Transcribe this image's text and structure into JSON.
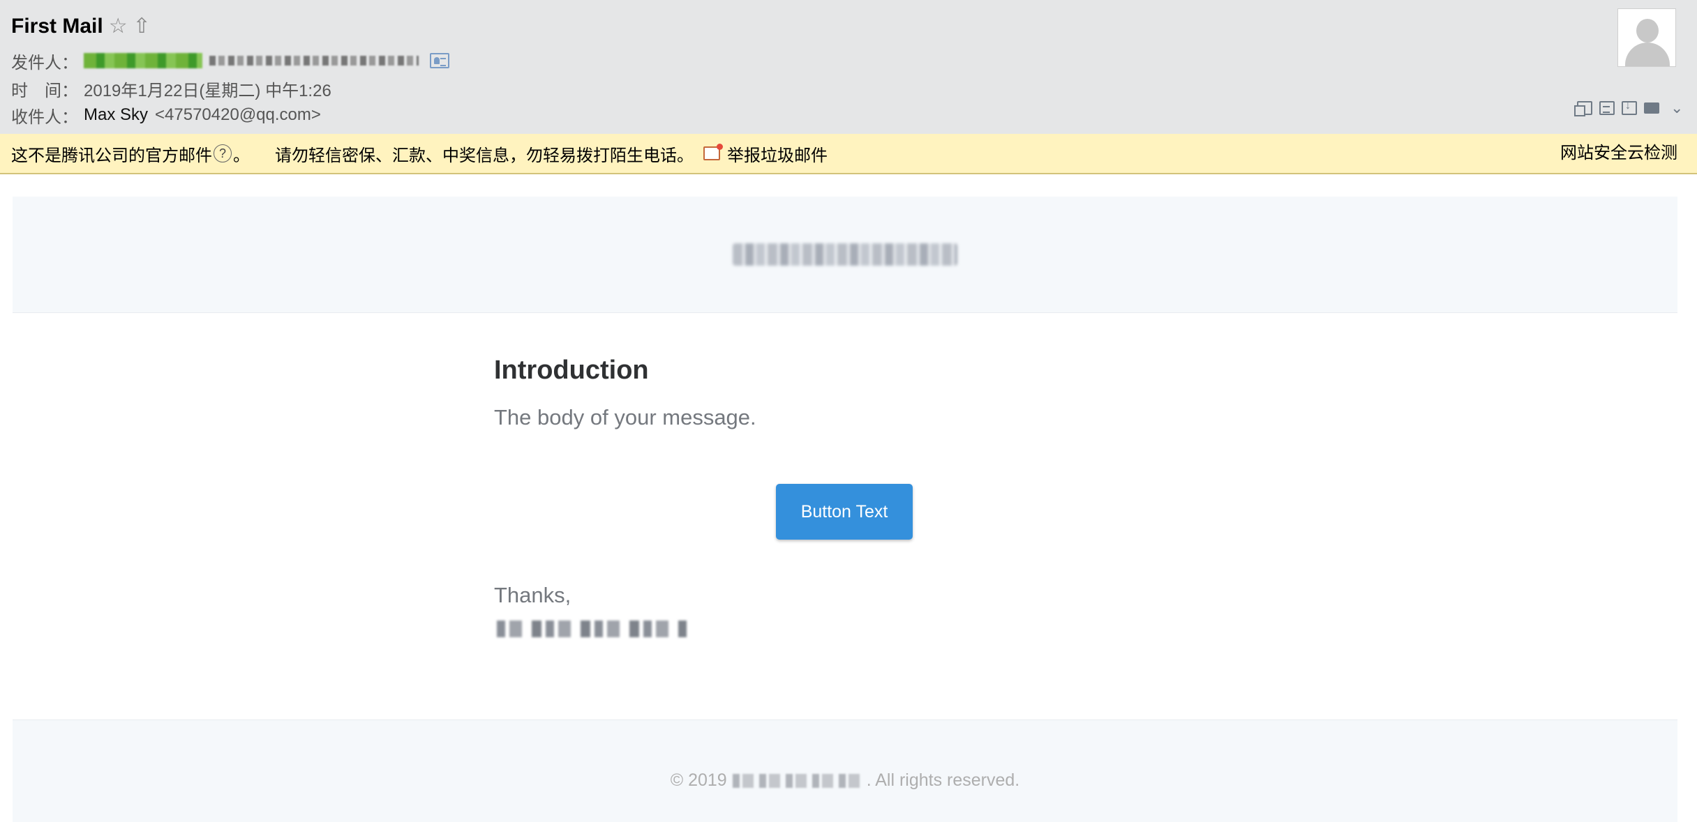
{
  "header": {
    "subject": "First Mail",
    "sender_label": "发件人：",
    "time_label": "时　间：",
    "time_value": "2019年1月22日(星期二) 中午1:26",
    "to_label": "收件人：",
    "to_name": "Max Sky",
    "to_email": "<47570420@qq.com>"
  },
  "icons": {
    "star": "☆",
    "share": "⇧",
    "chevron": "⌄"
  },
  "warning": {
    "text_before": "这不是腾讯公司的官方邮件",
    "help": "?",
    "text_after": "。",
    "text_tail": "请勿轻信密保、汇款、中奖信息，勿轻易拨打陌生电话。",
    "report_label": "举报垃圾邮件",
    "security_label": "网站安全云检测"
  },
  "email": {
    "intro": "Introduction",
    "body": "The body of your message.",
    "button_label": "Button Text",
    "thanks": "Thanks,"
  },
  "footer": {
    "copyright_prefix": "© 2019",
    "copyright_suffix": ". All rights reserved."
  },
  "colors": {
    "header_bg": "#e5e6e7",
    "warning_bg": "#fff3bf",
    "button_bg": "#3490dc",
    "email_bg": "#f5f8fb"
  }
}
